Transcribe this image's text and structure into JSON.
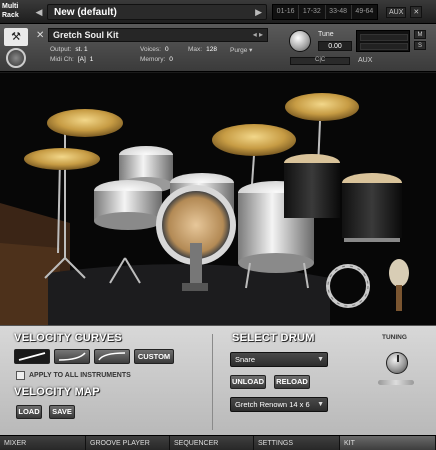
{
  "rack": {
    "logo_line1": "Multi",
    "logo_line2": "Rack",
    "preset_name": "New (default)",
    "pages": [
      "01-16",
      "17-32",
      "33-48",
      "49-64"
    ],
    "aux_label": "AUX",
    "kit_label": "KIT"
  },
  "instrument": {
    "name": "Gretch Soul Kit",
    "output_label": "Output:",
    "output_value": "st. 1",
    "midi_label": "Midi Ch:",
    "midi_port": "[A]",
    "midi_channel": "1",
    "voices_label": "Voices:",
    "voices_value": "0",
    "max_label": "Max:",
    "max_value": "128",
    "memory_label": "Memory:",
    "memory_value": "0",
    "purge_label": "Purge",
    "tune_label": "Tune",
    "tune_value": "0.00",
    "mute_label": "M",
    "solo_label": "S",
    "aux_label": "AUX",
    "pan_value": "C|C"
  },
  "velocity_curves": {
    "title": "VELOCITY CURVES",
    "custom_label": "CUSTOM",
    "apply_label": "APPLY TO ALL INSTRUMENTS",
    "apply_checked": false,
    "selected_curve": 0
  },
  "velocity_map": {
    "title": "VELOCITY MAP",
    "load_label": "LOAD",
    "save_label": "SAVE"
  },
  "select_drum": {
    "title": "SELECT DRUM",
    "drum_value": "Snare",
    "unload_label": "UNLOAD",
    "reload_label": "RELOAD",
    "sample_value": "Gretch Renown 14 x 6"
  },
  "tuning": {
    "label": "TUNING"
  },
  "tabs": [
    "MIXER",
    "GROOVE PLAYER",
    "SEQUENCER",
    "SETTINGS",
    "KIT"
  ],
  "colors": {
    "panel_bg": "#c8c8c8",
    "photo_bg": "#070707",
    "button_dark": "#3a3a3a",
    "cymbal": "#c9a24a"
  }
}
